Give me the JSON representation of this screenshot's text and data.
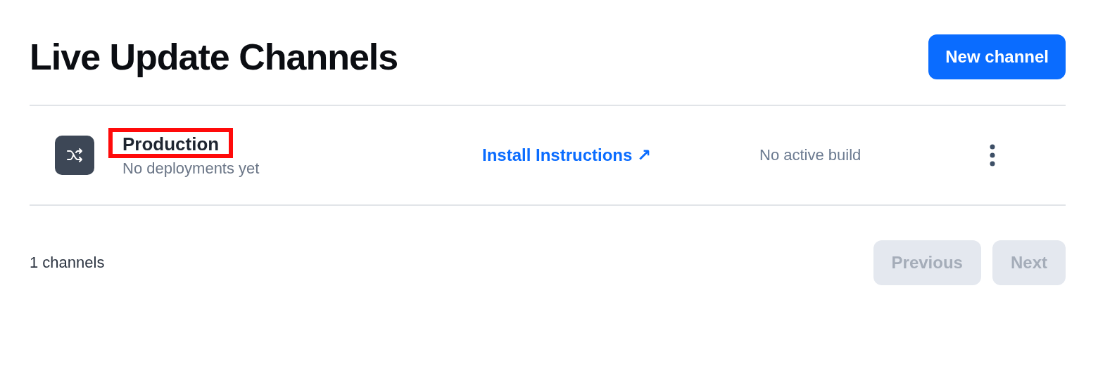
{
  "page": {
    "title": "Live Update Channels",
    "new_button": "New channel"
  },
  "channels": [
    {
      "name": "Production",
      "highlighted": true,
      "subtitle": "No deployments yet",
      "link": "Install Instructions",
      "link_icon": "↗",
      "build": "No active build"
    }
  ],
  "footer": {
    "count": "1 channels",
    "buttons": [
      {
        "label": "Previous",
        "disabled": true
      },
      {
        "label": "Next",
        "disabled": true
      }
    ]
  }
}
